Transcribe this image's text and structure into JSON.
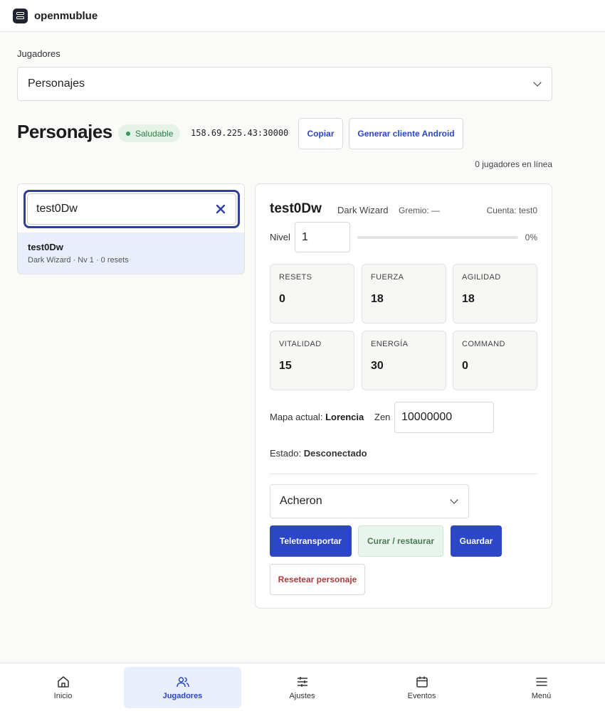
{
  "app": {
    "name": "openmublue"
  },
  "players": {
    "section_label": "Jugadores",
    "selected_view": "Personajes"
  },
  "header": {
    "title": "Personajes",
    "status": "Saludable",
    "server_address": "158.69.225.43:30000",
    "copy_label": "Copiar",
    "android_label": "Generar cliente Android",
    "online_text": "0 jugadores en línea"
  },
  "search": {
    "value": "test0Dw",
    "results": [
      {
        "name": "test0Dw",
        "sub": "Dark Wizard · Nv 1 · 0 resets"
      }
    ]
  },
  "character": {
    "name": "test0Dw",
    "class": "Dark Wizard",
    "guild": "Gremio: —",
    "account": "Cuenta: test0",
    "level_label": "Nivel",
    "level": "1",
    "progress_pct": 0,
    "progress_text": "0%",
    "stats": [
      {
        "key": "RESETS",
        "value": "0"
      },
      {
        "key": "FUERZA",
        "value": "18"
      },
      {
        "key": "AGILIDAD",
        "value": "18"
      },
      {
        "key": "VITALIDAD",
        "value": "15"
      },
      {
        "key": "ENERGÍA",
        "value": "30"
      },
      {
        "key": "COMMAND",
        "value": "0"
      }
    ],
    "map_label": "Mapa actual:",
    "map": "Lorencia",
    "zen_label": "Zen",
    "zen": "10000000",
    "state_label": "Estado:",
    "state": "Desconectado",
    "teleport_map": "Acheron",
    "actions": {
      "teleport": "Teletransportar",
      "heal": "Curar / restaurar",
      "save": "Guardar",
      "reset": "Resetear personaje"
    }
  },
  "nav": {
    "items": [
      {
        "label": "Inicio",
        "icon": "home-icon"
      },
      {
        "label": "Jugadores",
        "icon": "users-icon"
      },
      {
        "label": "Ajustes",
        "icon": "sliders-icon"
      },
      {
        "label": "Eventos",
        "icon": "calendar-icon"
      },
      {
        "label": "Menú",
        "icon": "menu-icon"
      }
    ]
  },
  "colors": {
    "accent": "#2b46c6",
    "healthy": "#2e7d47",
    "danger": "#b03a3a"
  }
}
